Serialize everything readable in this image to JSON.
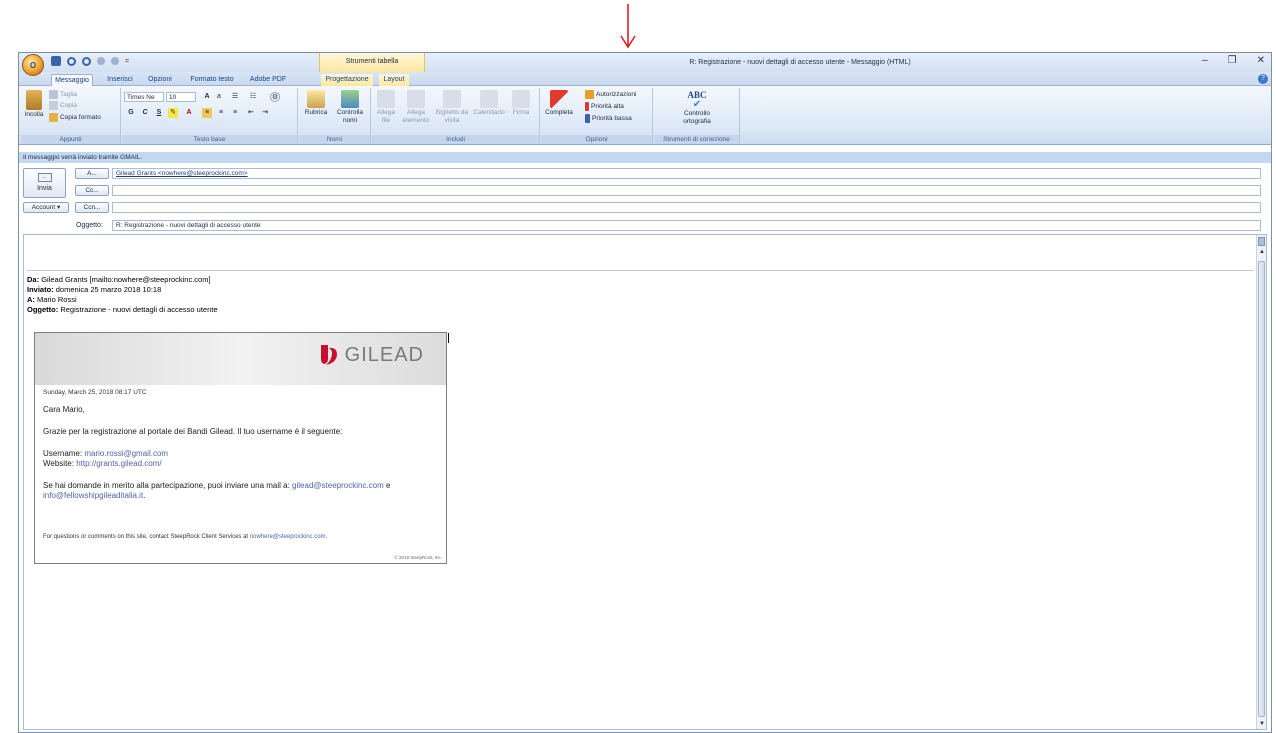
{
  "titlebar": {
    "office_button": "O",
    "qat_more": "=",
    "context_title": "Strumenti tabella",
    "window_title": "R: Registrazione - nuovi dettagli di accesso utente - Messaggio (HTML)",
    "min": "–",
    "restore": "❐",
    "close": "✕"
  },
  "tabs": [
    "Messaggio",
    "Inserisci",
    "Opzioni",
    "Formato testo",
    "Adobe PDF",
    "Progettazione",
    "Layout"
  ],
  "ribbon": {
    "appunti": {
      "label": "Appunti",
      "incolla": "Incolla",
      "taglia": "Taglia",
      "copia": "Copia",
      "copia_formato": "Copia formato"
    },
    "testo_base": {
      "label": "Testo base",
      "font": "Times Ne",
      "size": "10",
      "bold": "G",
      "italic": "C",
      "underline": "S"
    },
    "nomi": {
      "label": "Nomi",
      "rubrica": "Rubrica",
      "controlla_nomi": "Controlla nomi"
    },
    "includi": {
      "label": "Includi",
      "allega_file": "Allega file",
      "allega_elemento": "Allega elemento",
      "biglietto": "Biglietto da visita",
      "calendario": "Calendario",
      "firma": "Firma"
    },
    "opzioni": {
      "label": "Opzioni",
      "completa": "Completa",
      "autorizzazioni": "Autorizzazioni",
      "priorita_alta": "Priorità alta",
      "priorita_bassa": "Priorità bassa"
    },
    "correzione": {
      "label": "Strumenti di correzione",
      "abc": "ABC",
      "controllo": "Controllo ortografia"
    }
  },
  "infobar": "Il messaggio verrà inviato tramite GMAIL.",
  "compose": {
    "send": "Invia",
    "send_icon_text": "...",
    "to_btn": "A...",
    "cc_btn": "Cc...",
    "ccn_btn": "Ccn...",
    "account_btn": "Account",
    "to_value": "Gilead Grants <nowhere@steeprockinc.com>",
    "cc_value": "",
    "ccn_value": "",
    "subject_label": "Oggetto:",
    "subject_value": "R: Registrazione - nuovi dettagli di accesso utente"
  },
  "message": {
    "from_label": "Da:",
    "from_value": "Gilead Grants [mailto:nowhere@steeprockinc.com]",
    "sent_label": "Inviato:",
    "sent_value": "domenica 25 marzo 2018 10:18",
    "to_label": "A:",
    "to_value": "Mario Rossi",
    "subject_label": "Oggetto:",
    "subject_value": "Registrazione - nuovi dettagli di accesso utente"
  },
  "card": {
    "logo_text": "GILEAD",
    "date": "Sunday, March 25, 2018 08:17 UTC",
    "greeting": "Cara Mario,",
    "para1": "Grazie per la registrazione al portale dei Bandi Gilead. Il tuo username è il seguente:",
    "username_label": "Username: ",
    "username_value": "mario.rossi@gmail.com",
    "website_label": "Website: ",
    "website_value": "http://grants.gilead.com/",
    "para2_a": "Se hai domande in merito alla partecipazione, puoi inviare una mail a: ",
    "para2_link1": "gilead@steeprockinc.com",
    "para2_b": " e",
    "para2_link2": "info@fellowshipgileaditalia.it",
    "para2_c": ".",
    "footer_a": "For questions or comments on this site, contact SteepRock Client Services at ",
    "footer_link": "nowhere@steeprockinc.com",
    "footer_b": ".",
    "copyright": "© 2018 SteepRock, Inc."
  },
  "colors": {
    "ribbon_blue": "#dbe7f5",
    "context_yellow": "#fde89f",
    "link": "#5063a8",
    "arrow_red": "#e02020"
  }
}
